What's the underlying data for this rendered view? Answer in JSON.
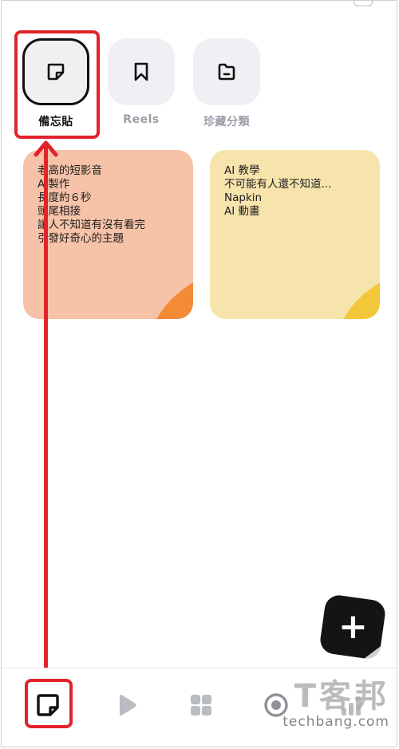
{
  "categories": [
    {
      "label": "備忘貼",
      "icon": "sticky-note-icon",
      "active": true
    },
    {
      "label": "Reels",
      "icon": "bookmark-icon",
      "active": false
    },
    {
      "label": "珍藏分類",
      "icon": "folder-icon",
      "active": false
    }
  ],
  "notes": [
    {
      "lines": [
        "老高的短影音",
        "AI製作",
        "長度約６秒",
        "頭尾相接",
        "讓人不知道有沒有看完",
        "引發好奇心的主題"
      ],
      "color": "#f6c2a8",
      "corner_color": "#f28a36"
    },
    {
      "lines": [
        "AI 教學",
        "不可能有人還不知道...",
        "Napkin",
        "AI 動畫"
      ],
      "color": "#f7e4ad",
      "corner_color": "#f2c73a"
    }
  ],
  "fab": {
    "label": "+",
    "icon": "plus-icon"
  },
  "bottom_nav": [
    {
      "icon": "sticky-note-icon",
      "active": true
    },
    {
      "icon": "play-icon",
      "active": false
    },
    {
      "icon": "grid-icon",
      "active": false
    },
    {
      "icon": "target-icon",
      "active": false
    },
    {
      "icon": "bar-chart-icon",
      "active": false
    }
  ],
  "watermark": {
    "cn": "T客邦",
    "en": "techbang.com"
  },
  "colors": {
    "highlight": "#e2232a",
    "tile_bg": "#eef0f3"
  }
}
